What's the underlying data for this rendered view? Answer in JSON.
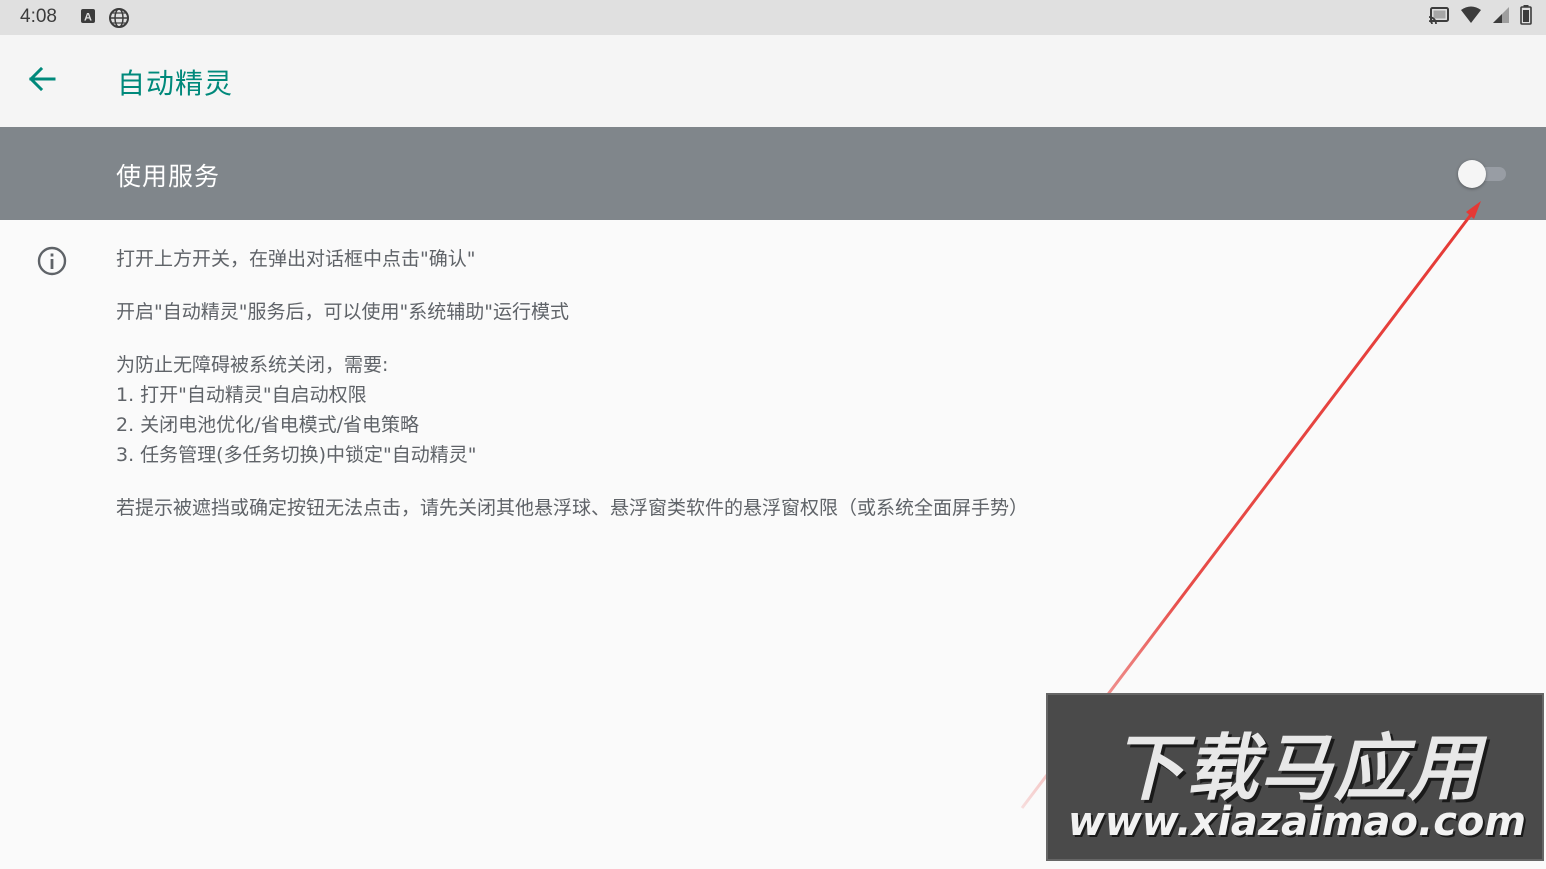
{
  "status_bar": {
    "time": "4:08",
    "left_icons": [
      "font-a-icon",
      "globe-icon"
    ],
    "right_icons": [
      "cast-icon",
      "wifi-icon",
      "cell-signal-icon",
      "battery-icon"
    ]
  },
  "app_bar": {
    "back_icon": "arrow-back-icon",
    "title": "自动精灵"
  },
  "service": {
    "label": "使用服务",
    "enabled": false
  },
  "info": {
    "icon": "info-icon",
    "lines": [
      "打开上方开关，在弹出对话框中点击\"确认\"",
      "开启\"自动精灵\"服务后，可以使用\"系统辅助\"运行模式",
      "为防止无障碍被系统关闭，需要:",
      "1. 打开\"自动精灵\"自启动权限",
      "2. 关闭电池优化/省电模式/省电策略",
      "3. 任务管理(多任务切换)中锁定\"自动精灵\"",
      "若提示被遮挡或确定按钮无法点击，请先关闭其他悬浮球、悬浮窗类软件的悬浮窗权限（或系统全面屏手势）"
    ]
  },
  "watermark": {
    "title": "下载马应用",
    "url": "www.xiazaimao.com"
  },
  "colors": {
    "accent": "#00897b",
    "service_bar": "#80868b",
    "annotation": "#e53935"
  }
}
